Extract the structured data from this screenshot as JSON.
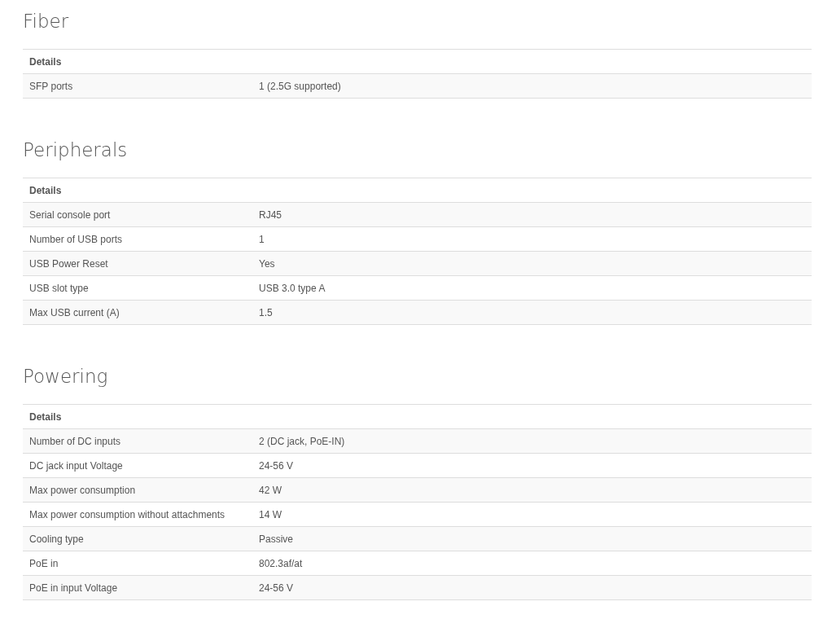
{
  "sections": [
    {
      "title": "Fiber",
      "header": "Details",
      "rows": [
        {
          "label": "SFP ports",
          "value": "1 (2.5G supported)"
        }
      ]
    },
    {
      "title": "Peripherals",
      "header": "Details",
      "rows": [
        {
          "label": "Serial console port",
          "value": "RJ45"
        },
        {
          "label": "Number of USB ports",
          "value": "1"
        },
        {
          "label": "USB Power Reset",
          "value": "Yes"
        },
        {
          "label": "USB slot type",
          "value": "USB 3.0 type A"
        },
        {
          "label": "Max USB current (A)",
          "value": "1.5"
        }
      ]
    },
    {
      "title": "Powering",
      "header": "Details",
      "rows": [
        {
          "label": "Number of DC inputs",
          "value": "2 (DC jack, PoE-IN)"
        },
        {
          "label": "DC jack input Voltage",
          "value": "24-56 V"
        },
        {
          "label": "Max power consumption",
          "value": "42 W"
        },
        {
          "label": "Max power consumption without attachments",
          "value": "14 W"
        },
        {
          "label": "Cooling type",
          "value": "Passive"
        },
        {
          "label": "PoE in",
          "value": "802.3af/at"
        },
        {
          "label": "PoE in input Voltage",
          "value": "24-56 V"
        }
      ]
    }
  ]
}
